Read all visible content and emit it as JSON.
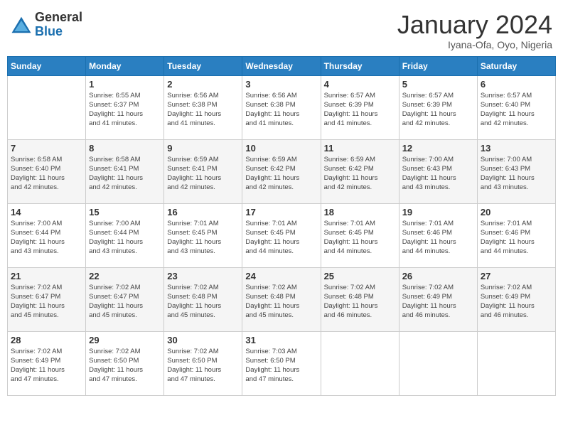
{
  "header": {
    "logo_general": "General",
    "logo_blue": "Blue",
    "month_year": "January 2024",
    "location": "Iyana-Ofa, Oyo, Nigeria"
  },
  "weekdays": [
    "Sunday",
    "Monday",
    "Tuesday",
    "Wednesday",
    "Thursday",
    "Friday",
    "Saturday"
  ],
  "weeks": [
    [
      {
        "day": null
      },
      {
        "day": 1,
        "sunrise": "6:55 AM",
        "sunset": "6:37 PM",
        "daylight": "11 hours and 41 minutes."
      },
      {
        "day": 2,
        "sunrise": "6:56 AM",
        "sunset": "6:38 PM",
        "daylight": "11 hours and 41 minutes."
      },
      {
        "day": 3,
        "sunrise": "6:56 AM",
        "sunset": "6:38 PM",
        "daylight": "11 hours and 41 minutes."
      },
      {
        "day": 4,
        "sunrise": "6:57 AM",
        "sunset": "6:39 PM",
        "daylight": "11 hours and 41 minutes."
      },
      {
        "day": 5,
        "sunrise": "6:57 AM",
        "sunset": "6:39 PM",
        "daylight": "11 hours and 42 minutes."
      },
      {
        "day": 6,
        "sunrise": "6:57 AM",
        "sunset": "6:40 PM",
        "daylight": "11 hours and 42 minutes."
      }
    ],
    [
      {
        "day": 7,
        "sunrise": "6:58 AM",
        "sunset": "6:40 PM",
        "daylight": "11 hours and 42 minutes."
      },
      {
        "day": 8,
        "sunrise": "6:58 AM",
        "sunset": "6:41 PM",
        "daylight": "11 hours and 42 minutes."
      },
      {
        "day": 9,
        "sunrise": "6:59 AM",
        "sunset": "6:41 PM",
        "daylight": "11 hours and 42 minutes."
      },
      {
        "day": 10,
        "sunrise": "6:59 AM",
        "sunset": "6:42 PM",
        "daylight": "11 hours and 42 minutes."
      },
      {
        "day": 11,
        "sunrise": "6:59 AM",
        "sunset": "6:42 PM",
        "daylight": "11 hours and 42 minutes."
      },
      {
        "day": 12,
        "sunrise": "7:00 AM",
        "sunset": "6:43 PM",
        "daylight": "11 hours and 43 minutes."
      },
      {
        "day": 13,
        "sunrise": "7:00 AM",
        "sunset": "6:43 PM",
        "daylight": "11 hours and 43 minutes."
      }
    ],
    [
      {
        "day": 14,
        "sunrise": "7:00 AM",
        "sunset": "6:44 PM",
        "daylight": "11 hours and 43 minutes."
      },
      {
        "day": 15,
        "sunrise": "7:00 AM",
        "sunset": "6:44 PM",
        "daylight": "11 hours and 43 minutes."
      },
      {
        "day": 16,
        "sunrise": "7:01 AM",
        "sunset": "6:45 PM",
        "daylight": "11 hours and 43 minutes."
      },
      {
        "day": 17,
        "sunrise": "7:01 AM",
        "sunset": "6:45 PM",
        "daylight": "11 hours and 44 minutes."
      },
      {
        "day": 18,
        "sunrise": "7:01 AM",
        "sunset": "6:45 PM",
        "daylight": "11 hours and 44 minutes."
      },
      {
        "day": 19,
        "sunrise": "7:01 AM",
        "sunset": "6:46 PM",
        "daylight": "11 hours and 44 minutes."
      },
      {
        "day": 20,
        "sunrise": "7:01 AM",
        "sunset": "6:46 PM",
        "daylight": "11 hours and 44 minutes."
      }
    ],
    [
      {
        "day": 21,
        "sunrise": "7:02 AM",
        "sunset": "6:47 PM",
        "daylight": "11 hours and 45 minutes."
      },
      {
        "day": 22,
        "sunrise": "7:02 AM",
        "sunset": "6:47 PM",
        "daylight": "11 hours and 45 minutes."
      },
      {
        "day": 23,
        "sunrise": "7:02 AM",
        "sunset": "6:48 PM",
        "daylight": "11 hours and 45 minutes."
      },
      {
        "day": 24,
        "sunrise": "7:02 AM",
        "sunset": "6:48 PM",
        "daylight": "11 hours and 45 minutes."
      },
      {
        "day": 25,
        "sunrise": "7:02 AM",
        "sunset": "6:48 PM",
        "daylight": "11 hours and 46 minutes."
      },
      {
        "day": 26,
        "sunrise": "7:02 AM",
        "sunset": "6:49 PM",
        "daylight": "11 hours and 46 minutes."
      },
      {
        "day": 27,
        "sunrise": "7:02 AM",
        "sunset": "6:49 PM",
        "daylight": "11 hours and 46 minutes."
      }
    ],
    [
      {
        "day": 28,
        "sunrise": "7:02 AM",
        "sunset": "6:49 PM",
        "daylight": "11 hours and 47 minutes."
      },
      {
        "day": 29,
        "sunrise": "7:02 AM",
        "sunset": "6:50 PM",
        "daylight": "11 hours and 47 minutes."
      },
      {
        "day": 30,
        "sunrise": "7:02 AM",
        "sunset": "6:50 PM",
        "daylight": "11 hours and 47 minutes."
      },
      {
        "day": 31,
        "sunrise": "7:03 AM",
        "sunset": "6:50 PM",
        "daylight": "11 hours and 47 minutes."
      },
      {
        "day": null
      },
      {
        "day": null
      },
      {
        "day": null
      }
    ]
  ]
}
